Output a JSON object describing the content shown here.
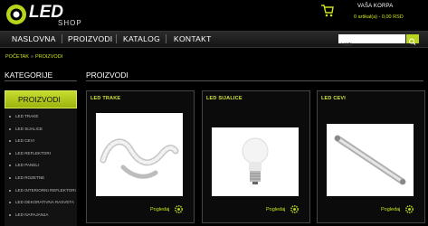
{
  "brand": {
    "logo_text": "LED SHOP",
    "accent_color": "#b8d41e"
  },
  "cart": {
    "title": "VAŠA KORPA",
    "status": "0 artikal(a) - 0,00 RSD",
    "icon": "cart-icon"
  },
  "nav": {
    "items": [
      {
        "label": "NASLOVNA"
      },
      {
        "label": "PROIZVODI"
      },
      {
        "label": "KATALOG"
      },
      {
        "label": "KONTAKT"
      }
    ]
  },
  "search": {
    "value": "Traži",
    "icon": "search-icon"
  },
  "breadcrumb": {
    "home": "POČETAK",
    "separator": "»",
    "current": "PROIZVODI"
  },
  "sidebar": {
    "heading": "KATEGORIJE",
    "active": "PROIZVODI",
    "items": [
      {
        "label": "LED TRAKE"
      },
      {
        "label": "LED SIJALICE"
      },
      {
        "label": "LED CEVI"
      },
      {
        "label": "LED REFLEKTORI"
      },
      {
        "label": "LED PANELI"
      },
      {
        "label": "LED ROZETNE"
      },
      {
        "label": "LED INTERIORNI REFLEKTORI"
      },
      {
        "label": "LED DEKORATIVNA RASVETA"
      },
      {
        "label": "LED NAPAJANJA"
      }
    ]
  },
  "main": {
    "heading": "PROIZVODI",
    "products": [
      {
        "title": "LED TRAKE",
        "link": "Pogledaj",
        "image": "led-strip-image"
      },
      {
        "title": "LED SIJALICE",
        "link": "Pogledaj",
        "image": "led-bulb-image"
      },
      {
        "title": "LED CEVI",
        "link": "Pogledaj",
        "image": "led-tube-image"
      }
    ]
  }
}
